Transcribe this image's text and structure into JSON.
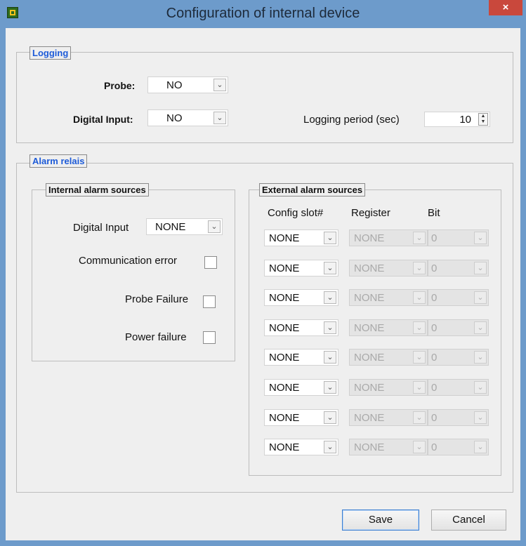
{
  "window": {
    "title": "Configuration of internal device",
    "close_label": "×"
  },
  "logging": {
    "group_label": "Logging",
    "probe_label": "Probe:",
    "probe_value": "NO",
    "digital_input_label": "Digital Input:",
    "digital_input_value": "NO",
    "period_label": "Logging period (sec)",
    "period_value": "10"
  },
  "alarm": {
    "group_label": "Alarm relais",
    "internal": {
      "group_label": "Internal alarm sources",
      "digital_input_label": "Digital Input",
      "digital_input_value": "NONE",
      "communication_error_label": "Communication error",
      "probe_failure_label": "Probe Failure",
      "power_failure_label": "Power failure"
    },
    "external": {
      "group_label": "External alarm sources",
      "col_config_slot": "Config slot#",
      "col_register": "Register",
      "col_bit": "Bit",
      "rows": [
        {
          "slot": "NONE",
          "register": "NONE",
          "bit": "0"
        },
        {
          "slot": "NONE",
          "register": "NONE",
          "bit": "0"
        },
        {
          "slot": "NONE",
          "register": "NONE",
          "bit": "0"
        },
        {
          "slot": "NONE",
          "register": "NONE",
          "bit": "0"
        },
        {
          "slot": "NONE",
          "register": "NONE",
          "bit": "0"
        },
        {
          "slot": "NONE",
          "register": "NONE",
          "bit": "0"
        },
        {
          "slot": "NONE",
          "register": "NONE",
          "bit": "0"
        },
        {
          "slot": "NONE",
          "register": "NONE",
          "bit": "0"
        }
      ]
    }
  },
  "buttons": {
    "save": "Save",
    "cancel": "Cancel"
  },
  "icons": {
    "dropdown": "chevron-down-icon",
    "spin": "spin-updown-icon",
    "app": "app-icon",
    "close": "close-icon"
  },
  "colors": {
    "accent": "#1d5bd8",
    "titlebar": "#6d9bcb",
    "close": "#c9483c"
  }
}
